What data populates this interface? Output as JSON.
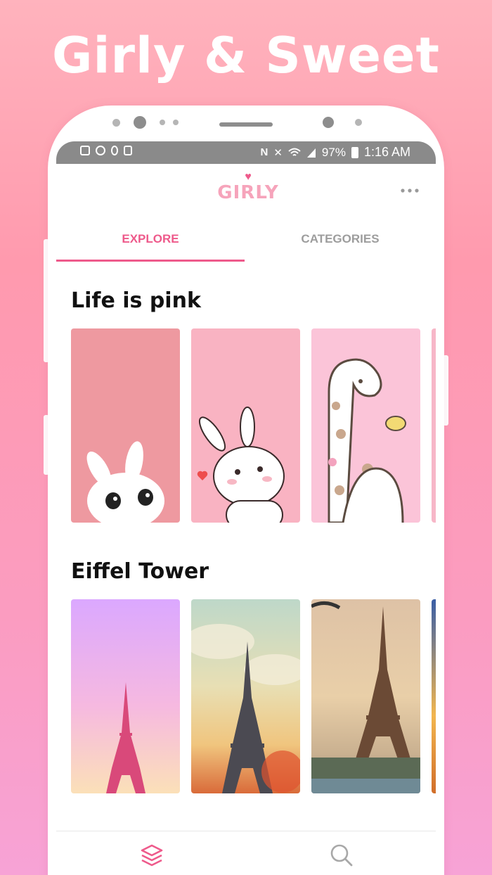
{
  "promo": {
    "title": "Girly & Sweet"
  },
  "status_bar": {
    "battery": "97%",
    "time": "1:16 AM"
  },
  "app": {
    "logo_text": "GIRLY",
    "more_icon": "more-dots-icon"
  },
  "tabs": [
    {
      "label": "EXPLORE",
      "active": true
    },
    {
      "label": "CATEGORIES",
      "active": false
    }
  ],
  "sections": [
    {
      "title": "Life is pink",
      "images": [
        "bunny-pink-wallpaper",
        "bunny-heart-wallpaper",
        "giraffe-bird-wallpaper"
      ]
    },
    {
      "title": "Eiffel Tower",
      "images": [
        "eiffel-pink-sky-wallpaper",
        "eiffel-clouds-wallpaper",
        "eiffel-sunset-wallpaper"
      ]
    }
  ],
  "bottom_nav": [
    {
      "icon": "layers-icon",
      "active": true
    },
    {
      "icon": "search-icon",
      "active": false
    }
  ],
  "colors": {
    "accent": "#ee5a8b",
    "inactive": "#9d9d9d",
    "logo": "#f6a4bb"
  }
}
